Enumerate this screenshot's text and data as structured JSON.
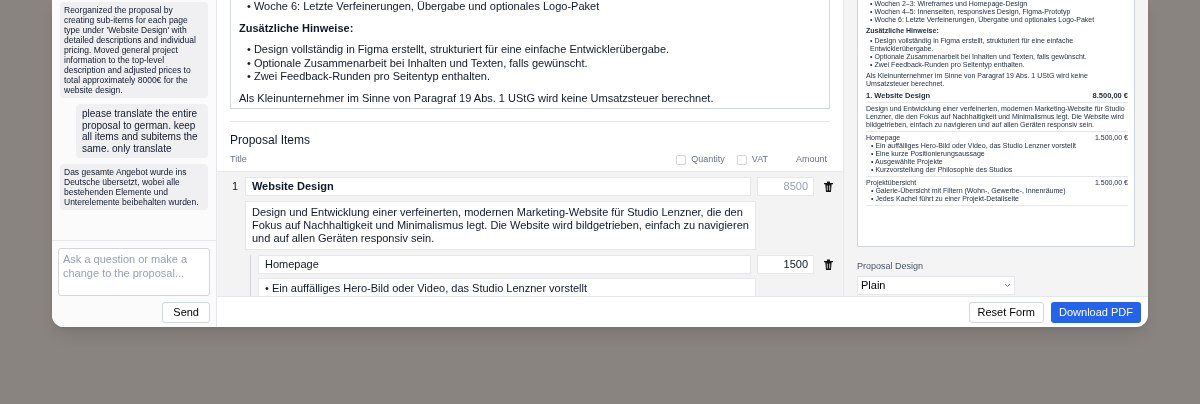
{
  "chat": {
    "messages": [
      {
        "kind": "assistant",
        "text": "Reorganized the proposal by creating sub-items for each page type under 'Website Design' with detailed descriptions and individual pricing. Moved general project information to the top-level description and adjusted prices to total approximately 8000€ for the website design."
      },
      {
        "kind": "user",
        "text": "please translate the entire proposal to german. keep all items and subitems the same. only translate"
      },
      {
        "kind": "assistant",
        "text": "Das gesamte Angebot wurde ins Deutsche übersetzt, wobei alle bestehenden Elemente und Unterelemente beibehalten wurden."
      }
    ],
    "input": {
      "placeholder": "Ask a question or make a change to the proposal..."
    },
    "send_button": "Send"
  },
  "editor": {
    "description": [
      {
        "kind": "bullet",
        "text": "• Woche 6: Letzte Verfeinerungen, Übergabe und optionales Logo-Paket"
      },
      {
        "kind": "heading",
        "text": "Zusätzliche Hinweise:"
      },
      {
        "kind": "bullet",
        "text": "• Design vollständig in Figma erstellt, strukturiert für eine einfache Entwicklerübergabe."
      },
      {
        "kind": "bullet",
        "text": "• Optionale Zusammenarbeit bei Inhalten und Texten, falls gewünscht."
      },
      {
        "kind": "bullet",
        "text": "• Zwei Feedback-Runden pro Seitentyp enthalten."
      },
      {
        "kind": "paragraph",
        "text": "Als Kleinunternehmer im Sinne von Paragraf 19 Abs. 1 UStG wird keine Umsatzsteuer berechnet."
      }
    ],
    "items_heading": "Proposal Items",
    "columns": {
      "title": "Title",
      "quantity": {
        "label": "Quantity",
        "checked": false
      },
      "vat": {
        "label": "VAT",
        "checked": false
      },
      "amount": "Amount"
    },
    "items": [
      {
        "number": "1",
        "title": "Website Design",
        "amount": "8500",
        "amount_disabled": true,
        "description": "Design und Entwicklung einer verfeinerten, modernen Marketing-Website für Studio Lenzner, die den Fokus auf Nachhaltigkeit und Minimalismus legt. Die Website wird bildgetrieben, einfach zu navigieren und auf allen Geräten responsiv sein.",
        "children": [
          {
            "title": "Homepage",
            "amount": "1500",
            "amount_disabled": false,
            "bullets": [
              "• Ein auffälliges Hero-Bild oder Video, das Studio Lenzner vorstellt"
            ]
          }
        ]
      }
    ]
  },
  "preview": {
    "blocks": [
      {
        "kind": "bullet",
        "text": "• Wochen 2–3: Wireframes und Homepage-Design"
      },
      {
        "kind": "bullet",
        "text": "• Wochen 4–5: Innenseiten, responsives Design, Figma-Prototyp"
      },
      {
        "kind": "bullet",
        "text": "• Woche 6: Letzte Verfeinerungen, Übergabe und optionales Logo-Paket"
      },
      {
        "kind": "heading",
        "text": "Zusätzliche Hinweise:"
      },
      {
        "kind": "bullet",
        "text": "• Design vollständig in Figma erstellt, strukturiert für eine einfache Entwicklerübergabe."
      },
      {
        "kind": "bullet",
        "text": "• Optionale Zusammenarbeit bei Inhalten und Texten, falls gewünscht."
      },
      {
        "kind": "bullet",
        "text": "• Zwei Feedback-Runden pro Seitentyp enthalten."
      },
      {
        "kind": "paragraph",
        "text": "Als Kleinunternehmer im Sinne von Paragraf 19 Abs. 1 UStG wird keine Umsatzsteuer berechnet."
      }
    ],
    "items": [
      {
        "title": "1. Website Design",
        "price": "8.500,00 €",
        "description": "Design und Entwicklung einer verfeinerten, modernen Marketing-Website für Studio Lenzner, die den Fokus auf Nachhaltigkeit und Minimalismus legt. Die Website wird bildgetrieben, einfach zu navigieren und auf allen Geräten responsiv sein.",
        "children": [
          {
            "title": "Homepage",
            "price": "1.500,00 €",
            "bullets": [
              "• Ein auffälliges Hero-Bild oder Video, das Studio Lenzner vorstellt",
              "• Eine kurze Positionierungsaussage",
              "• Ausgewählte Projekte",
              "• Kurzvorstellung der Philosophie des Studios"
            ]
          },
          {
            "title": "Projektübersicht",
            "price": "1.500,00 €",
            "bullets": [
              "• Galerie-Übersicht mit Filtern (Wohn-, Gewerbe-, Innenräume)",
              "• Jedes Kachel führt zu einer Projekt-Detailseite"
            ]
          }
        ]
      }
    ],
    "design_label": "Proposal Design",
    "design_value": "Plain"
  },
  "footer": {
    "reset_button": "Reset Form",
    "download_button": "Download PDF"
  }
}
